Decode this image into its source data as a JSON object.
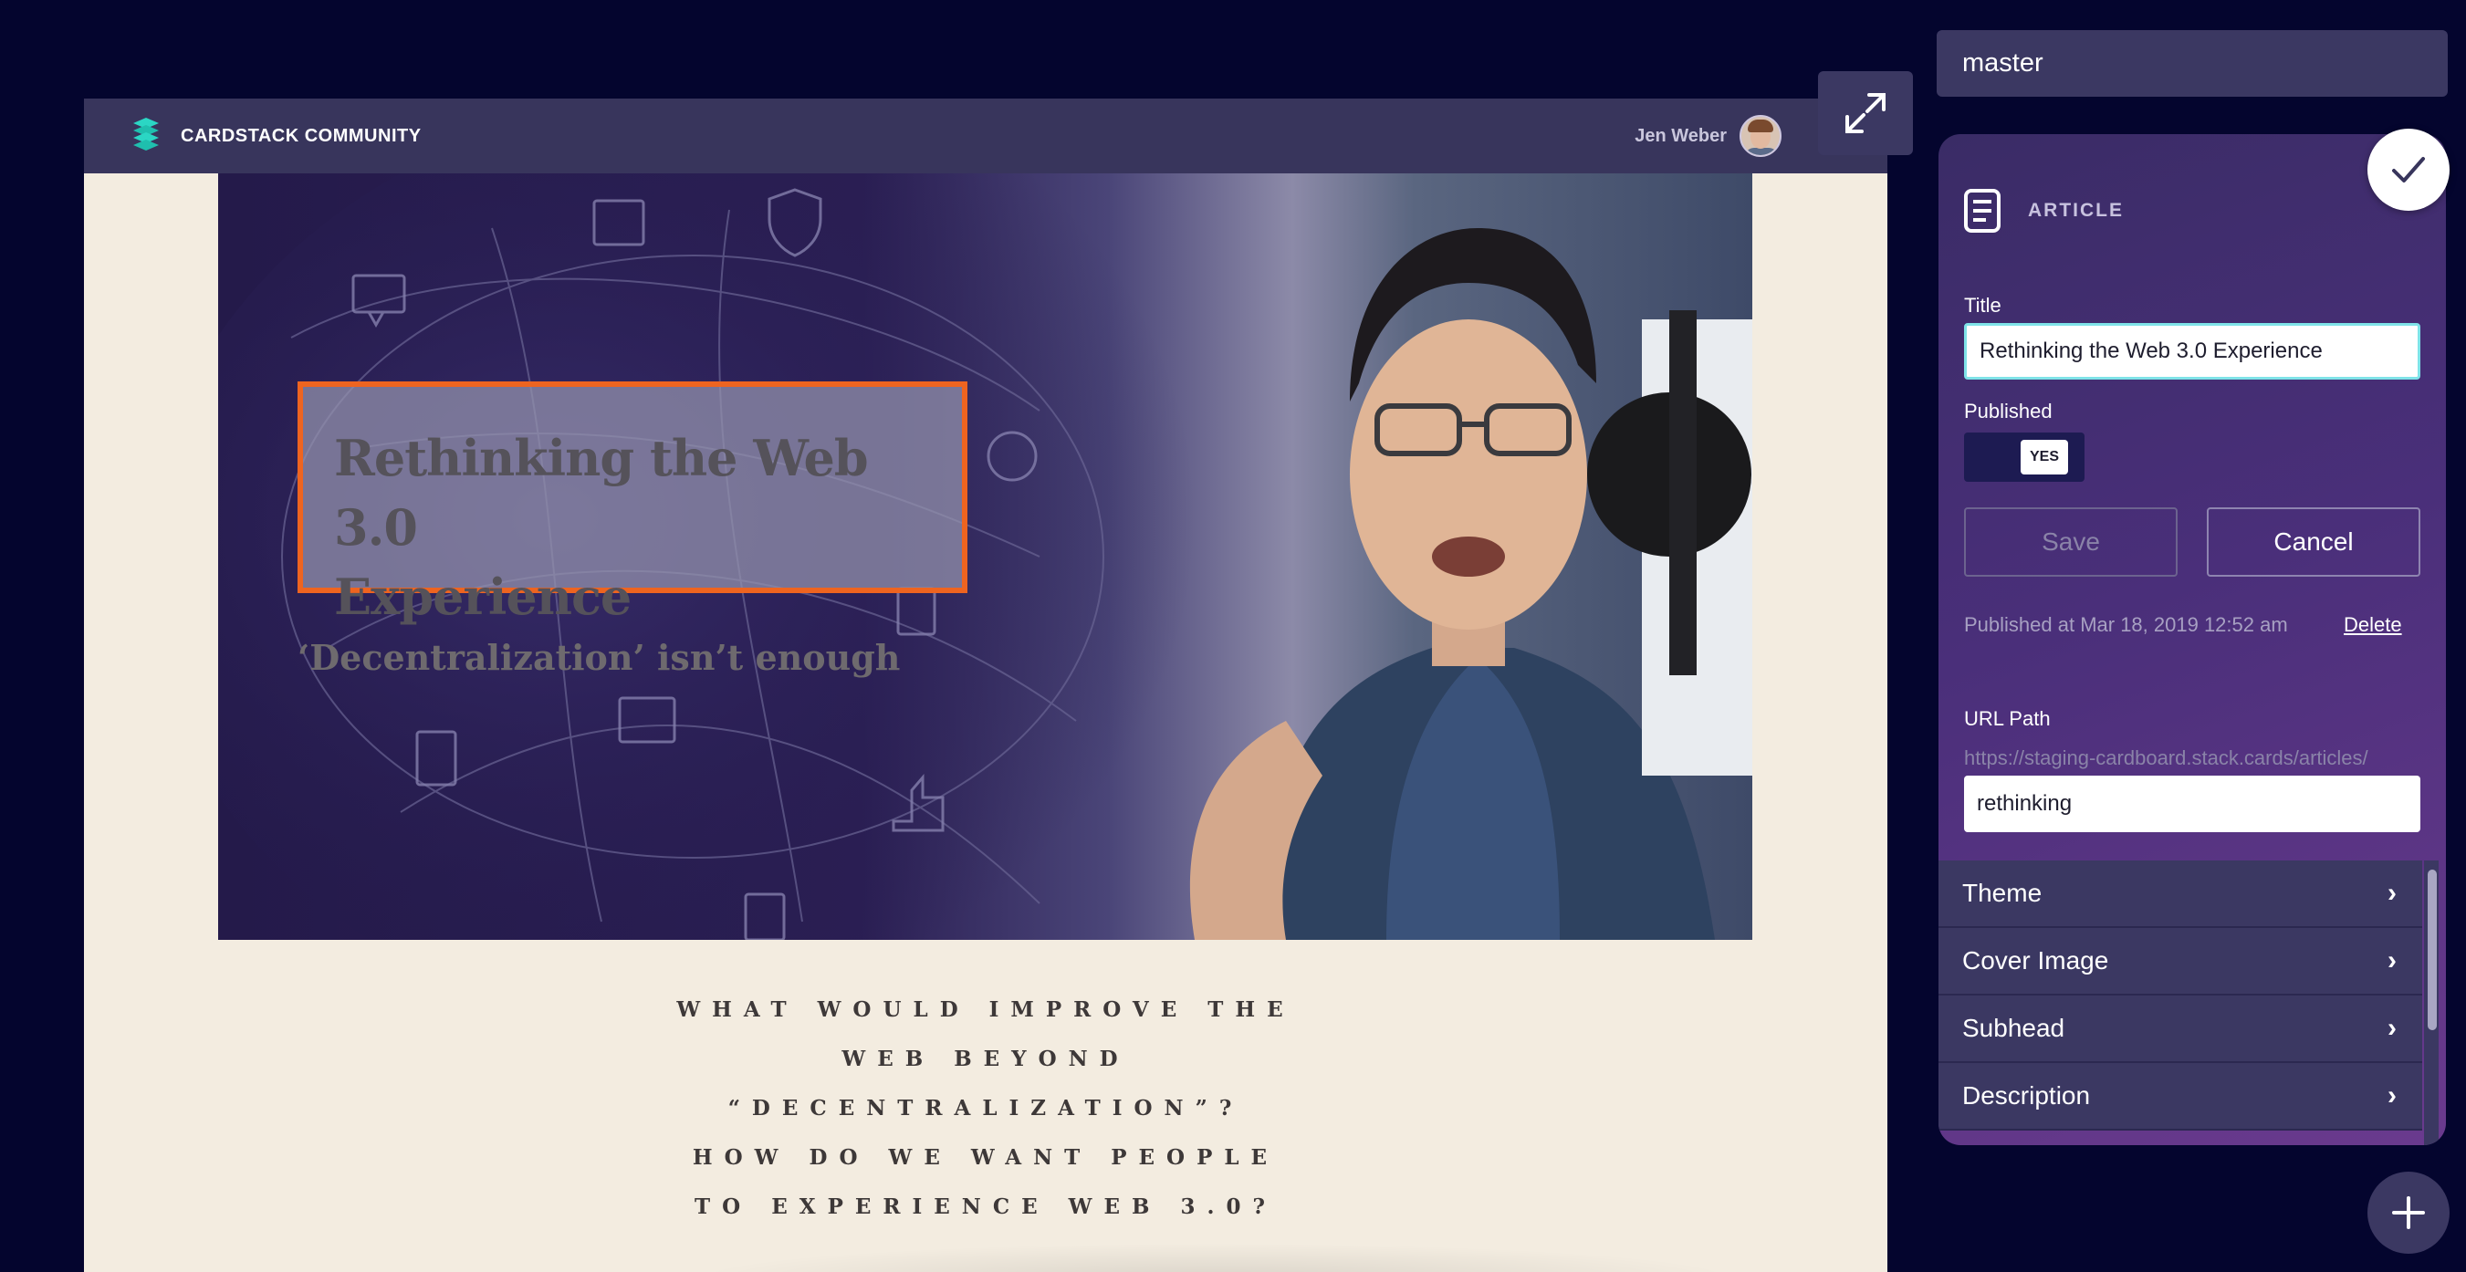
{
  "branch": "master",
  "header": {
    "brand_name": "CARDSTACK COMMUNITY",
    "user_name": "Jen Weber"
  },
  "hero": {
    "title_line1": "Rethinking the Web 3.0",
    "title_line2": "Experience",
    "subtitle": "‘Decentralization’ isn’t enough"
  },
  "body_lines": [
    "WHAT WOULD IMPROVE THE",
    "WEB BEYOND",
    "“DECENTRALIZATION”?",
    "HOW DO WE WANT PEOPLE",
    "TO EXPERIENCE WEB 3.0?"
  ],
  "editor": {
    "card_type": "ARTICLE",
    "title_label": "Title",
    "title_value": "Rethinking the Web 3.0 Experience",
    "published_label": "Published",
    "published_toggle": "YES",
    "save_label": "Save",
    "cancel_label": "Cancel",
    "published_at": "Published at Mar 18, 2019 12:52 am",
    "delete_label": "Delete",
    "url_path_label": "URL Path",
    "url_prefix": "https://staging-cardboard.stack.cards/articles/",
    "url_value": "rethinking",
    "sections": [
      {
        "label": "Theme"
      },
      {
        "label": "Cover Image"
      },
      {
        "label": "Subhead"
      },
      {
        "label": "Description"
      }
    ]
  },
  "icons": {
    "expand": "expand-icon",
    "check": "check-icon",
    "add": "plus-icon",
    "document": "document-icon",
    "chevron": "chevron-right-icon"
  },
  "colors": {
    "background": "#04052e",
    "panel": "#3b3862",
    "highlight": "#ee6420",
    "focus": "#7fe3e8"
  }
}
